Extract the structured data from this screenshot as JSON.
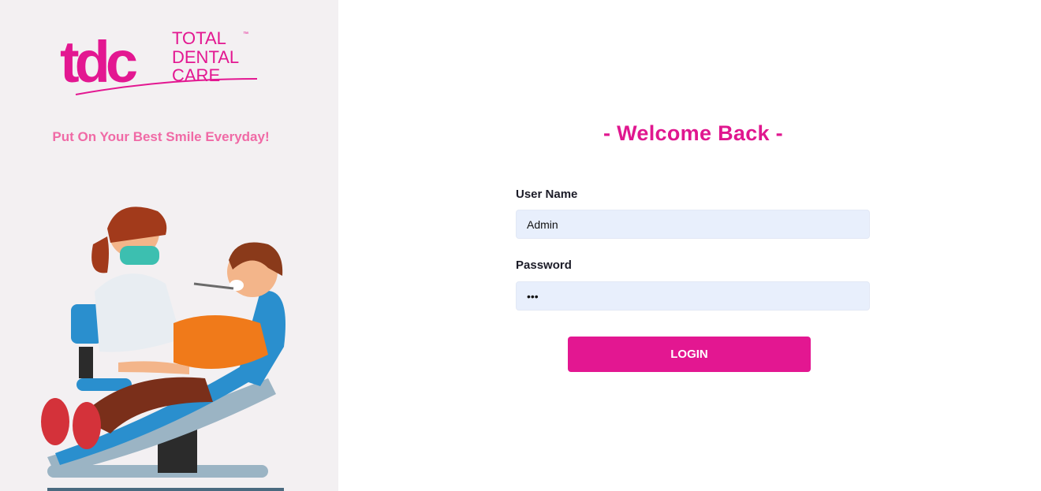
{
  "brand": {
    "logo_letters": "tdc",
    "logo_line1": "TOTAL",
    "logo_line2": "DENTAL",
    "logo_line3": "CARE",
    "trademark": "™",
    "tagline": "Put On Your Best Smile Everyday!"
  },
  "login": {
    "heading": "- Welcome Back -",
    "username_label": "User Name",
    "username_value": "Admin",
    "password_label": "Password",
    "password_value": "abc",
    "submit_label": "LOGIN"
  },
  "colors": {
    "brand_pink": "#e31791",
    "tagline_pink": "#f06aa6",
    "input_bg": "#e8effc",
    "left_panel_bg": "#f3f0f2"
  },
  "icons": {
    "illustration": "dentist-patient-illustration"
  }
}
